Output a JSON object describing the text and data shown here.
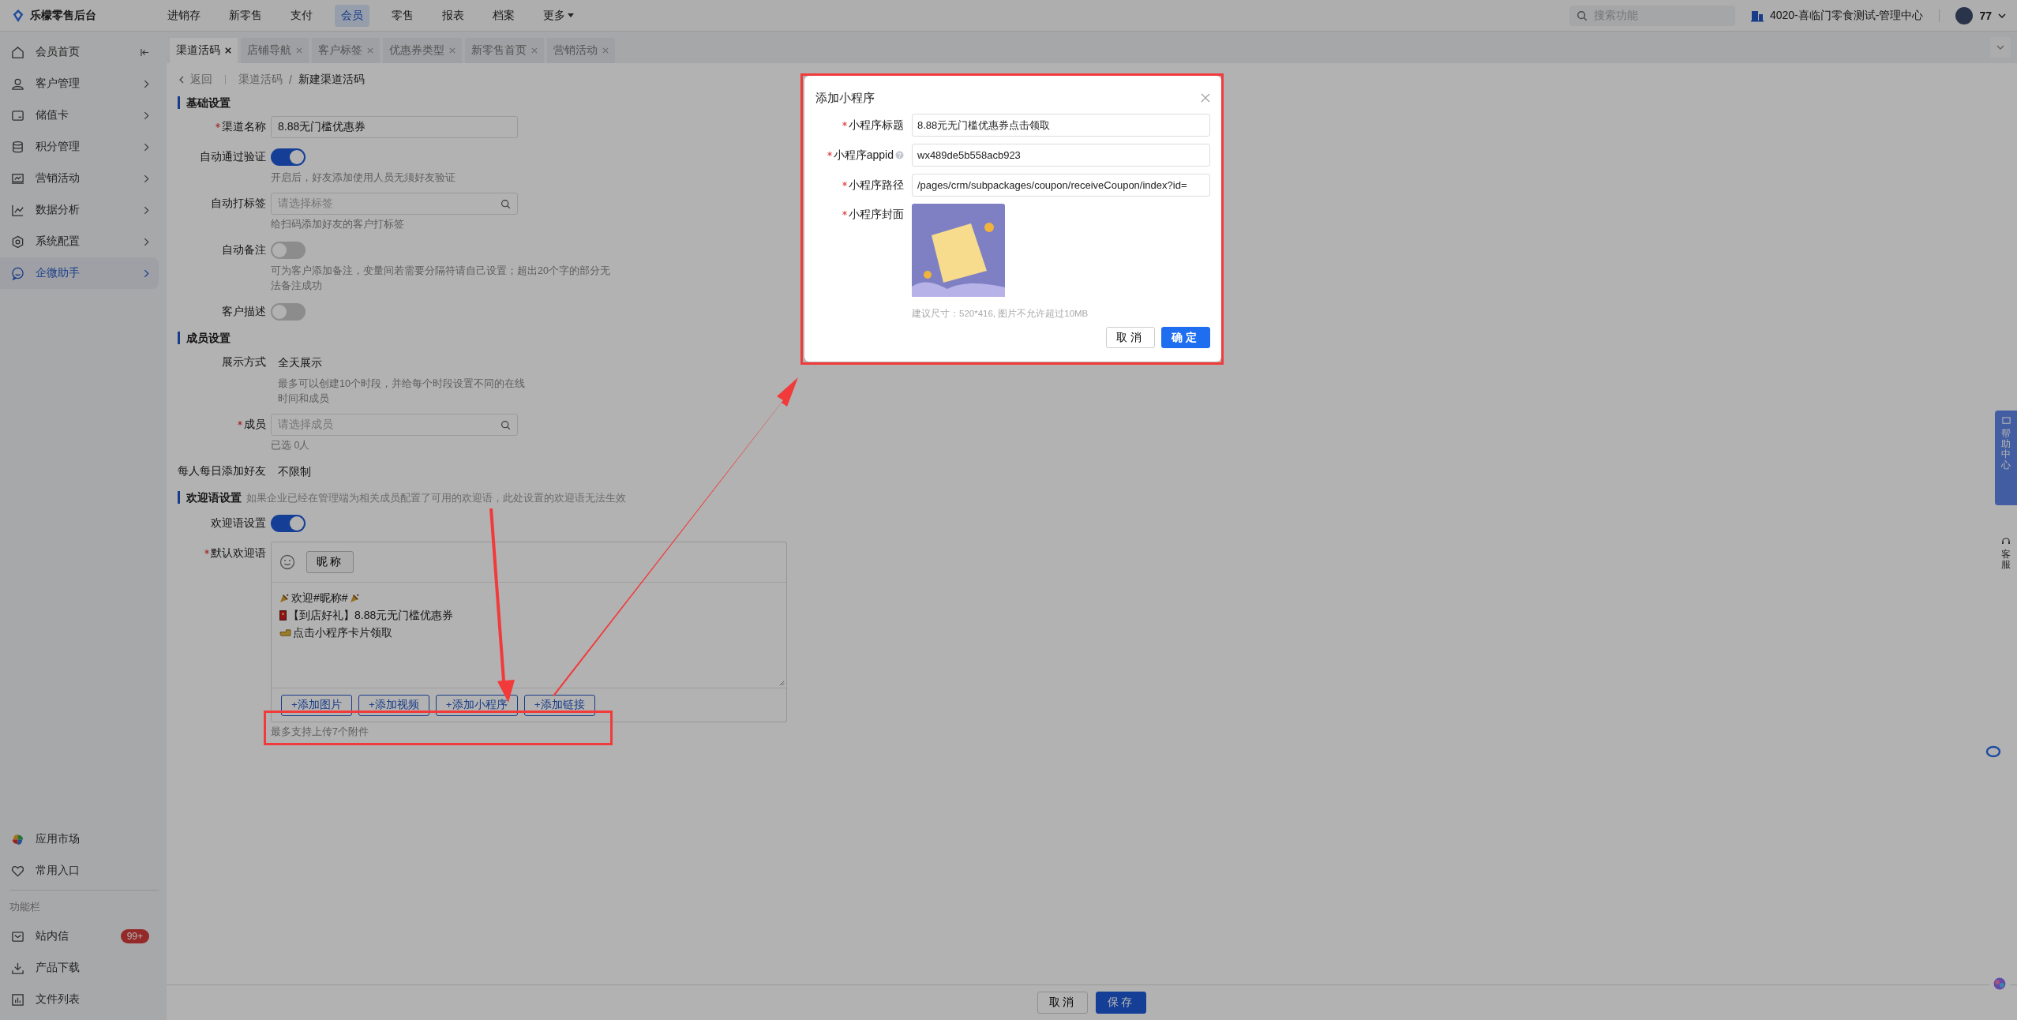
{
  "app": {
    "name": "乐檬零售后台"
  },
  "top_nav": [
    {
      "label": "进销存",
      "selected": false
    },
    {
      "label": "新零售",
      "selected": false
    },
    {
      "label": "支付",
      "selected": false
    },
    {
      "label": "会员",
      "selected": true
    },
    {
      "label": "零售",
      "selected": false
    },
    {
      "label": "报表",
      "selected": false
    },
    {
      "label": "档案",
      "selected": false
    }
  ],
  "more_menu": {
    "label": "更多"
  },
  "search": {
    "placeholder": "搜索功能"
  },
  "store": {
    "name": "4020-喜临门零食测试-管理中心"
  },
  "user": {
    "name": "77"
  },
  "sidebar": {
    "items": [
      {
        "label": "会员首页",
        "selected": false
      },
      {
        "label": "客户管理",
        "selected": false
      },
      {
        "label": "储值卡",
        "selected": false
      },
      {
        "label": "积分管理",
        "selected": false
      },
      {
        "label": "营销活动",
        "selected": false
      },
      {
        "label": "数据分析",
        "selected": false
      },
      {
        "label": "系统配置",
        "selected": false
      },
      {
        "label": "企微助手",
        "selected": true
      }
    ],
    "bottom_items": [
      {
        "label": "应用市场"
      },
      {
        "label": "常用入口"
      }
    ],
    "section_title": "功能栏",
    "tools": [
      {
        "label": "站内信",
        "badge": "99+"
      },
      {
        "label": "产品下载"
      },
      {
        "label": "文件列表"
      }
    ]
  },
  "tabs": [
    {
      "label": "渠道活码",
      "selected": true
    },
    {
      "label": "店铺导航",
      "selected": false
    },
    {
      "label": "客户标签",
      "selected": false
    },
    {
      "label": "优惠券类型",
      "selected": false
    },
    {
      "label": "新零售首页",
      "selected": false
    },
    {
      "label": "营销活动",
      "selected": false
    }
  ],
  "breadcrumb": {
    "back": "返回",
    "separator": "/",
    "items": [
      "渠道活码",
      "新建渠道活码"
    ]
  },
  "sections": [
    {
      "title": "基础设置",
      "rows": [
        {
          "kind": "input",
          "label": "渠道名称",
          "required": true,
          "value": "8.88无门槛优惠券"
        },
        {
          "kind": "toggle",
          "label": "自动通过验证",
          "on": true,
          "hint": "开启后，好友添加使用人员无须好友验证"
        },
        {
          "kind": "search",
          "label": "自动打标签",
          "placeholder": "请选择标签",
          "hint": "给扫码添加好友的客户打标签"
        },
        {
          "kind": "toggle",
          "label": "自动备注",
          "on": false,
          "hint": "可为客户添加备注，变量间若需要分隔符请自己设置；超出20个字的部分无法备注成功"
        },
        {
          "kind": "toggle",
          "label": "客户描述",
          "on": false
        }
      ]
    },
    {
      "title": "成员设置",
      "rows": [
        {
          "kind": "text",
          "label": "展示方式",
          "value": "全天展示",
          "hint": "最多可以创建10个时段，并给每个时段设置不同的在线时间和成员"
        },
        {
          "kind": "search",
          "label": "成员",
          "required": true,
          "placeholder": "请选择成员",
          "hint": "已选 0人"
        },
        {
          "kind": "text",
          "label": "每人每日添加好友",
          "value": "不限制"
        }
      ]
    },
    {
      "title": "欢迎语设置",
      "note": "如果企业已经在管理端为相关成员配置了可用的欢迎语，此处设置的欢迎语无法生效",
      "rows": [
        {
          "kind": "toggle",
          "label": "欢迎语设置",
          "on": true
        },
        {
          "kind": "editor",
          "label": "默认欢迎语",
          "required": true,
          "nickname_button": "昵称",
          "lines": [
            {
              "kind": "popper",
              "text": "欢迎#昵称#"
            },
            {
              "kind": "envelope",
              "text": "【到店好礼】8.88元无门槛优惠券"
            },
            {
              "kind": "pointing",
              "text": "点击小程序卡片领取"
            }
          ],
          "attach_buttons": [
            "+添加图片",
            "+添加视频",
            "+添加小程序",
            "+添加链接"
          ],
          "hint": "最多支持上传7个附件"
        }
      ]
    }
  ],
  "footer": {
    "cancel": "取消",
    "save": "保存"
  },
  "dialog": {
    "title": "添加小程序",
    "fields": [
      {
        "label": "小程序标题",
        "required": true,
        "value": "8.88元无门槛优惠券点击领取",
        "help": false
      },
      {
        "label": "小程序appid",
        "required": true,
        "value": "wx489de5b558acb923",
        "help": true
      },
      {
        "label": "小程序路径",
        "required": true,
        "value": "/pages/crm/subpackages/coupon/receiveCoupon/index?id=",
        "help": false
      }
    ],
    "cover": {
      "label": "小程序封面",
      "required": true,
      "hint": "建议尺寸：520*416, 图片不允许超过10MB"
    },
    "cancel": "取消",
    "ok": "确定"
  },
  "right_dock": {
    "help": "帮助中心",
    "service": "客服"
  }
}
